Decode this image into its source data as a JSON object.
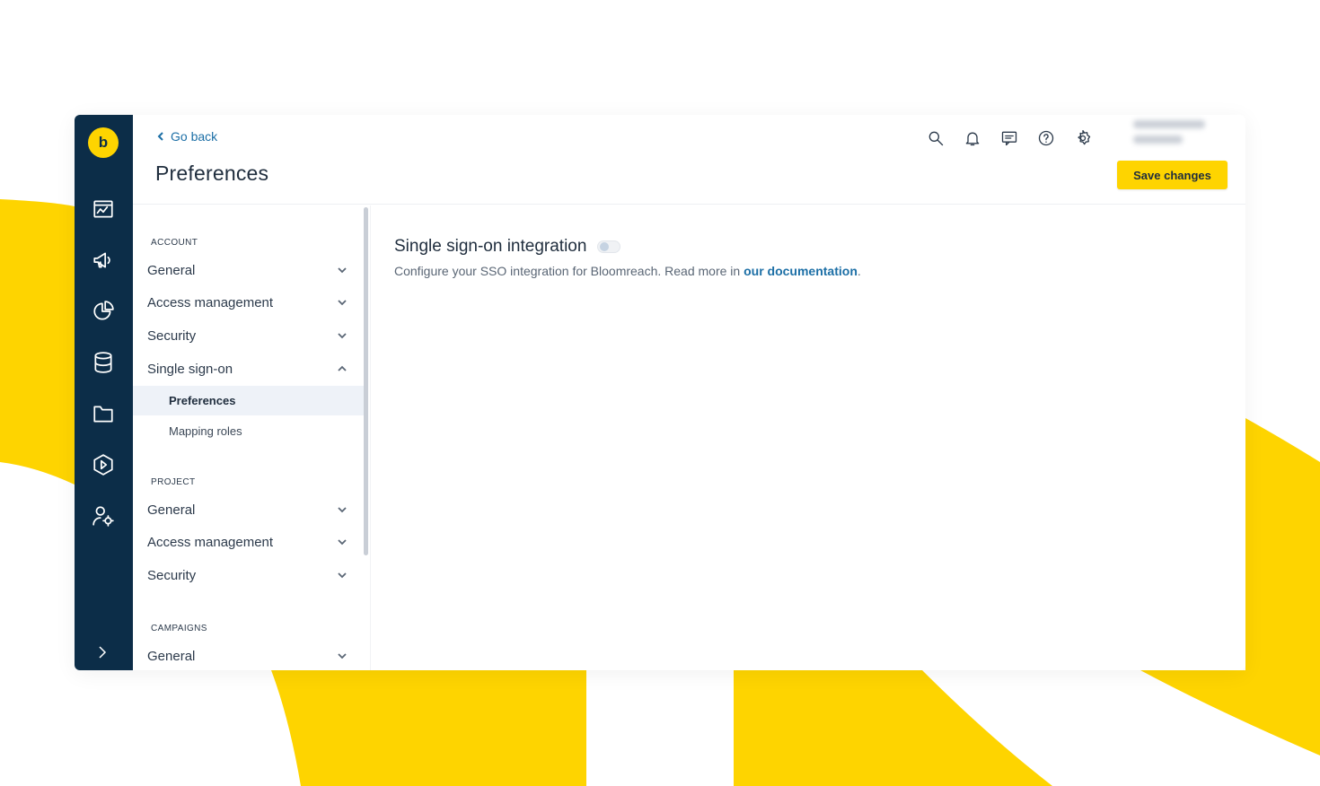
{
  "colors": {
    "brand_yellow": "#fed400",
    "rail_navy": "#0c2d48",
    "link_blue": "#1c6fa6",
    "active_row": "#eef2f8"
  },
  "header": {
    "go_back": "Go back",
    "title": "Preferences",
    "save_label": "Save changes",
    "icons": [
      "search-icon",
      "bell-icon",
      "chat-icon",
      "help-icon",
      "gear-icon"
    ]
  },
  "rail": {
    "logo": "b",
    "icons": [
      "dashboard-icon",
      "megaphone-icon",
      "pie-chart-icon",
      "database-icon",
      "folder-icon",
      "play-hexagon-icon",
      "user-settings-icon"
    ],
    "expand_icon": "chevron-right-icon"
  },
  "sidenav": {
    "account": {
      "label": "ACCOUNT",
      "items": [
        "General",
        "Access management",
        "Security",
        "Single sign-on"
      ],
      "sub_items": [
        "Preferences",
        "Mapping roles"
      ]
    },
    "project": {
      "label": "PROJECT",
      "items": [
        "General",
        "Access management",
        "Security"
      ]
    },
    "campaigns": {
      "label": "CAMPAIGNS",
      "items": [
        "General"
      ]
    }
  },
  "content": {
    "title": "Single sign-on integration",
    "desc_prefix": "Configure your SSO integration for Bloomreach. Read more in ",
    "desc_link": "our documentation",
    "desc_suffix": "."
  }
}
